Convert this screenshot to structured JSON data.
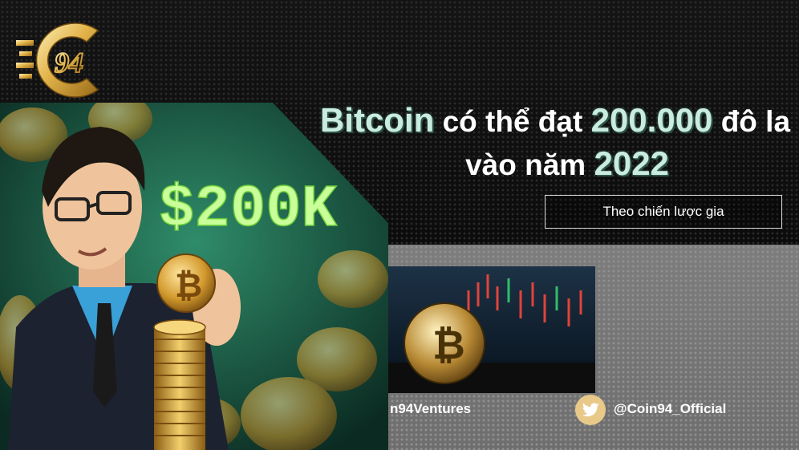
{
  "headline": {
    "w1": "Bitcoin",
    "w2": "có thể đạt",
    "w3": "200.000",
    "w4": "đô la",
    "w5": "vào năm",
    "w6": "2022"
  },
  "subtitle": "Theo chiến lược gia",
  "logo": {
    "text": "94"
  },
  "illustration": {
    "sign_text": "$200K",
    "coin_symbol": "₿"
  },
  "social": {
    "left_handle": "n94Ventures",
    "right_handle": "@Coin94_Official",
    "right_icon": "twitter-bird-icon"
  },
  "colors": {
    "accent": "#c9ecdf",
    "gold": "#d8a63b",
    "neon_green": "#b8ff7a"
  }
}
